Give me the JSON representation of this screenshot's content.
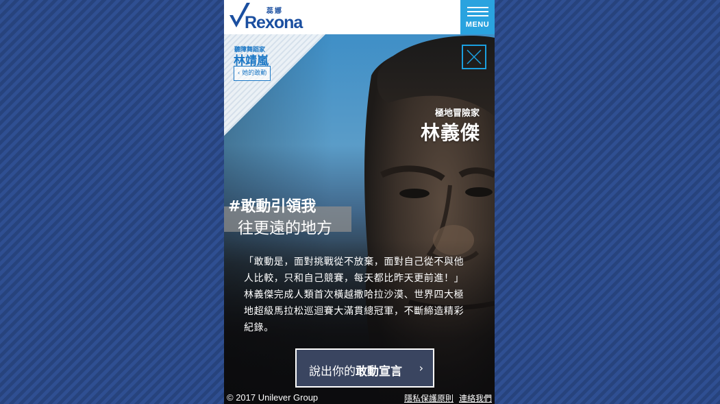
{
  "brand": {
    "sub": "蕊娜",
    "name": "Rexona",
    "color": "#1b4fa0"
  },
  "menu": {
    "label": "MENU",
    "color": "#2aa3df"
  },
  "corner_card": {
    "role": "聽障舞蹈家",
    "name": "林靖嵐",
    "link_label": "‹ 她的敢動"
  },
  "profile": {
    "role": "極地冒險家",
    "name": "林義傑"
  },
  "campaign": {
    "hashtag": "#敢動引領我",
    "subline": "往更遠的地方"
  },
  "quote": {
    "lines": [
      "「敢動是，面對挑戰從不放棄，面對自己從不與他",
      "人比較，只和自己競賽，每天都比昨天更前進！」",
      "林義傑完成人類首次橫越撒哈拉沙漠、世界四大極",
      "地超級馬拉松巡迴賽大滿貫總冠軍，不斷締造精彩",
      "紀錄。"
    ]
  },
  "cta": {
    "prefix": "說出你的",
    "emphasis": "敢動宣言",
    "arrow": "›"
  },
  "footer": {
    "copyright": "© 2017 Unilever Group",
    "privacy": "隱私保護原則",
    "contact": "連絡我們"
  },
  "icons": {
    "menu": "hamburger-icon",
    "close": "close-icon",
    "logo_mark": "checkmark-icon"
  },
  "colors": {
    "accent": "#1aa0e0",
    "background": "#2c4a8a"
  }
}
